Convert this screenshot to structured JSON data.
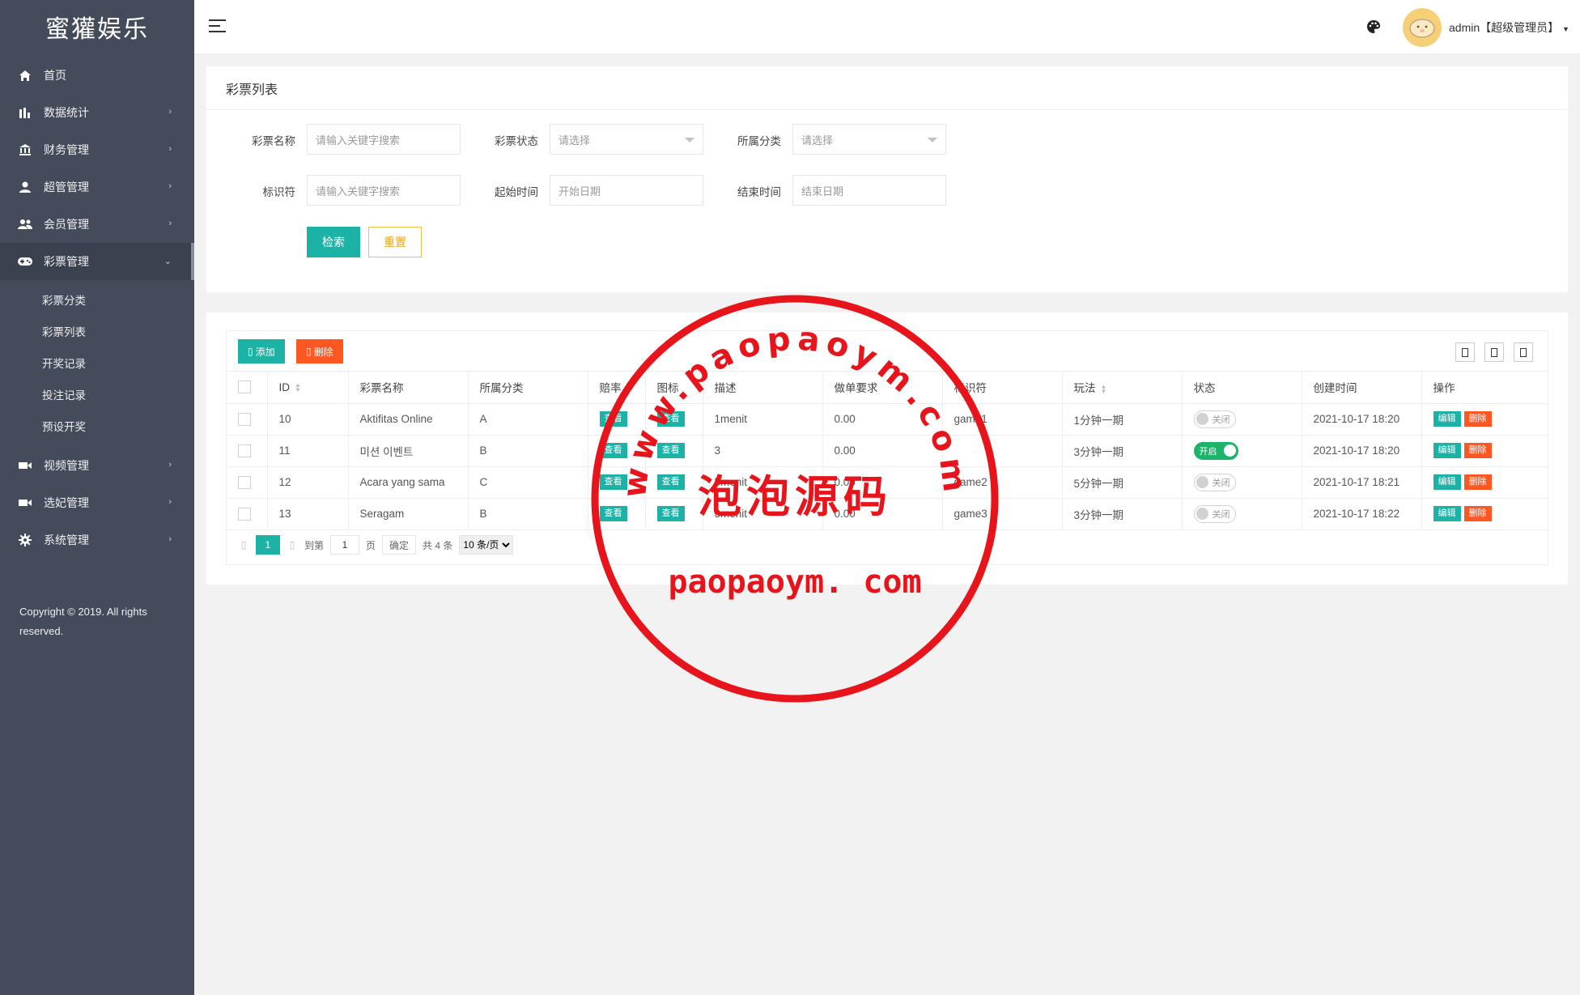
{
  "app": {
    "brand": "蜜獾娱乐"
  },
  "sidebar": {
    "items": [
      {
        "label": "首页",
        "icon": "home-icon",
        "has_arrow": false
      },
      {
        "label": "数据统计",
        "icon": "bar-chart-icon",
        "has_arrow": true
      },
      {
        "label": "财务管理",
        "icon": "bank-icon",
        "has_arrow": true
      },
      {
        "label": "超管管理",
        "icon": "user-icon",
        "has_arrow": true
      },
      {
        "label": "会员管理",
        "icon": "users-icon",
        "has_arrow": true
      },
      {
        "label": "彩票管理",
        "icon": "gamepad-icon",
        "has_arrow": true,
        "open": true
      }
    ],
    "subitems": [
      "彩票分类",
      "彩票列表",
      "开奖记录",
      "投注记录",
      "预设开奖"
    ],
    "items_after": [
      {
        "label": "视频管理",
        "icon": "video-icon"
      },
      {
        "label": "选妃管理",
        "icon": "video-icon"
      },
      {
        "label": "系统管理",
        "icon": "gear-icon"
      }
    ],
    "copyright": "Copyright © 2019. All rights reserved."
  },
  "header": {
    "user": "admin【超级管理员】"
  },
  "search": {
    "title": "彩票列表",
    "fields": [
      {
        "label": "彩票名称",
        "placeholder": "请输入关键字搜索",
        "type": "text"
      },
      {
        "label": "彩票状态",
        "placeholder": "请选择",
        "type": "select"
      },
      {
        "label": "所属分类",
        "placeholder": "请选择",
        "type": "select"
      },
      {
        "label": "标识符",
        "placeholder": "请输入关键字搜索",
        "type": "text"
      },
      {
        "label": "起始时间",
        "placeholder": "开始日期",
        "type": "text"
      },
      {
        "label": "结束时间",
        "placeholder": "结束日期",
        "type": "text"
      }
    ],
    "search_btn": "检索",
    "reset_btn": "重置"
  },
  "table": {
    "add_btn": "添加",
    "delete_btn": "删除",
    "columns": [
      "ID",
      "彩票名称",
      "所属分类",
      "赔率",
      "图标",
      "描述",
      "做单要求",
      "标识符",
      "玩法",
      "状态",
      "创建时间",
      "操作"
    ],
    "view_label": "查看",
    "edit_label": "编辑",
    "del_label": "删除",
    "rows": [
      {
        "id": "10",
        "name": "Aktifitas Online",
        "category": "A",
        "desc": "1menit",
        "requirement": "0.00",
        "identifier": "game1",
        "play": "1分钟一期",
        "status": "关闭",
        "on": false,
        "created": "2021-10-17 18:20"
      },
      {
        "id": "11",
        "name": "미션 이벤트",
        "category": "B",
        "desc": "3",
        "requirement": "0.00",
        "identifier": "",
        "play": "3分钟一期",
        "status": "开启",
        "on": true,
        "created": "2021-10-17 18:20"
      },
      {
        "id": "12",
        "name": "Acara yang sama",
        "category": "C",
        "desc": "5menit",
        "requirement": "0.00",
        "identifier": "game2",
        "play": "5分钟一期",
        "status": "关闭",
        "on": false,
        "created": "2021-10-17 18:21"
      },
      {
        "id": "13",
        "name": "Seragam",
        "category": "B",
        "desc": "3menit",
        "requirement": "0.00",
        "identifier": "game3",
        "play": "3分钟一期",
        "status": "关闭",
        "on": false,
        "created": "2021-10-17 18:22"
      }
    ],
    "pager": {
      "current": "1",
      "goto_label": "到第",
      "page_input": "1",
      "page_unit": "页",
      "confirm": "确定",
      "total": "共 4 条",
      "per_page": "10 条/页"
    }
  },
  "watermark": {
    "arc_text": "www.paopaoym.com",
    "center_text": "泡泡源码",
    "bottom_text": "paopaoym. com",
    "color": "#e8141b"
  }
}
